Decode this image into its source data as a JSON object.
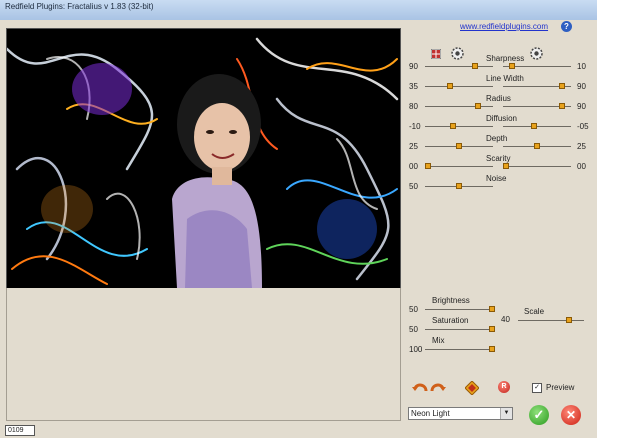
{
  "window": {
    "title": "Redfield Plugins: Fractalius v 1.83 (32-bit)",
    "website_link": "www.redfieldplugins.com",
    "help_label": "?"
  },
  "status": {
    "text": "0109"
  },
  "top_sliders": [
    {
      "label": "Sharpness",
      "left_value": "90",
      "right_value": "10",
      "left_level": 0.76,
      "right_level": 0.1
    },
    {
      "label": "Line Width",
      "left_value": "35",
      "right_value": "90",
      "left_level": 0.35,
      "right_level": 0.9
    },
    {
      "label": "Radius",
      "left_value": "80",
      "right_value": "90",
      "left_level": 0.8,
      "right_level": 0.9
    },
    {
      "label": "Diffusion",
      "left_value": "-10",
      "right_value": "-05",
      "left_level": 0.4,
      "right_level": 0.45
    },
    {
      "label": "Depth",
      "left_value": "25",
      "right_value": "25",
      "left_level": 0.5,
      "right_level": 0.5
    },
    {
      "label": "Scarity",
      "left_value": "00",
      "right_value": "00",
      "left_level": 0.0,
      "right_level": 0.0
    },
    {
      "label": "Noise",
      "left_value": "50",
      "left_level": 0.5
    }
  ],
  "bottom_sliders": [
    {
      "label": "Brightness",
      "value": "50",
      "level": 1.0
    },
    {
      "label": "Saturation",
      "value": "50",
      "level": 1.0
    },
    {
      "label": "Mix",
      "value": "100",
      "level": 1.0
    }
  ],
  "scale": {
    "label": "Scale",
    "value": "40",
    "level": 0.8
  },
  "preview": {
    "label": "Preview",
    "checked": true,
    "check_glyph": "✓"
  },
  "preset": {
    "selected": "Neon Light"
  },
  "colors": {
    "knob": "#e8a21c",
    "background": "#e2dccf",
    "ok": "#2a9a1e",
    "cancel": "#cc1f12"
  },
  "icons": {
    "grid": "grid-icon",
    "gear_left": "gear-icon",
    "gear_right": "gear-icon",
    "undo": "undo-arrow-icon",
    "redo": "redo-arrow-icon",
    "random": "diamond-icon",
    "reset": "reset-icon",
    "ok": "checkmark-icon",
    "cancel": "close-icon"
  },
  "buttons": {
    "ok_glyph": "✓",
    "cancel_glyph": "✕",
    "reset_glyph": "R",
    "combo_arrow": "▼"
  }
}
